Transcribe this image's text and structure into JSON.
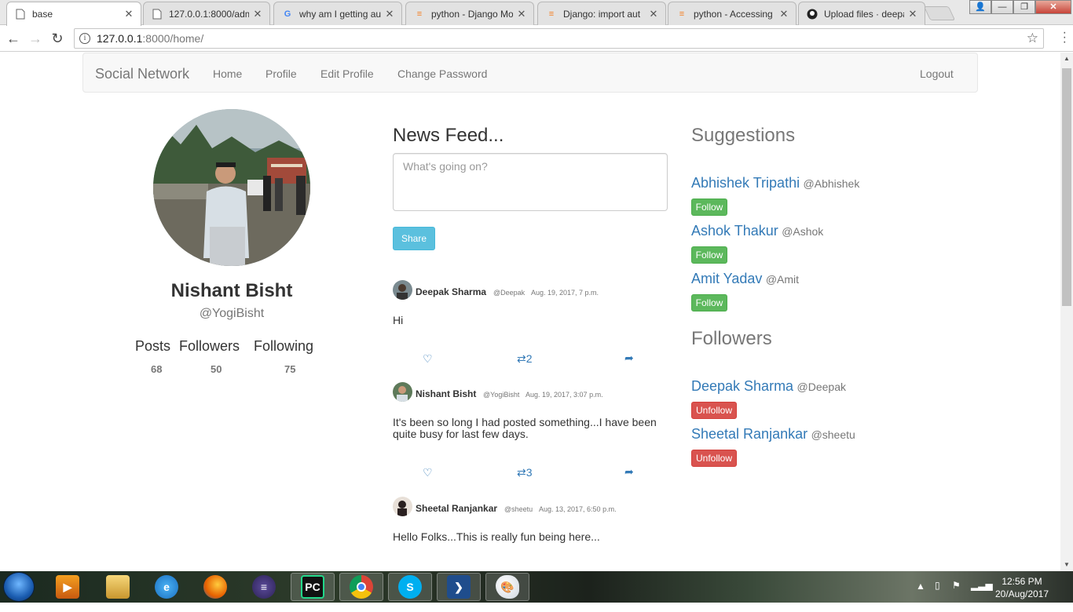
{
  "browser": {
    "tabs": [
      {
        "title": "base",
        "icon": "document-icon",
        "active": true
      },
      {
        "title": "127.0.0.1:8000/admi",
        "icon": "document-icon",
        "active": false
      },
      {
        "title": "why am I getting au",
        "icon": "google-icon",
        "active": false
      },
      {
        "title": "python - Django Mo",
        "icon": "stackoverflow-icon",
        "active": false
      },
      {
        "title": "Django: import aut",
        "icon": "stackoverflow-icon",
        "active": false
      },
      {
        "title": "python - Accessing",
        "icon": "stackoverflow-icon",
        "active": false
      },
      {
        "title": "Upload files · deepa",
        "icon": "github-icon",
        "active": false
      }
    ],
    "url_host": "127.0.0.1",
    "url_path": ":8000/home/"
  },
  "navbar": {
    "brand": "Social Network",
    "links": [
      "Home",
      "Profile",
      "Edit Profile",
      "Change Password"
    ],
    "logout": "Logout"
  },
  "profile": {
    "name": "Nishant Bisht",
    "handle": "@YogiBisht",
    "stats": [
      {
        "label": "Posts",
        "value": "68"
      },
      {
        "label": "Followers",
        "value": "50"
      },
      {
        "label": "Following",
        "value": "75"
      }
    ]
  },
  "feed": {
    "title": "News Feed...",
    "placeholder": "What's going on?",
    "share_label": "Share",
    "posts": [
      {
        "author": "Deepak Sharma",
        "handle": "@Deepak",
        "date": "Aug. 19, 2017, 7 p.m.",
        "body": "Hi",
        "retweets": "2"
      },
      {
        "author": "Nishant Bisht",
        "handle": "@YogiBisht",
        "date": "Aug. 19, 2017, 3:07 p.m.",
        "body": "It's been so long I had posted something...I have been quite busy for last few days.",
        "retweets": "3"
      },
      {
        "author": "Sheetal Ranjankar",
        "handle": "@sheetu",
        "date": "Aug. 13, 2017, 6:50 p.m.",
        "body": "Hello Folks...This is really fun being here...",
        "retweets": ""
      }
    ]
  },
  "suggestions": {
    "title": "Suggestions",
    "people": [
      {
        "name": "Abhishek Tripathi",
        "handle": "@Abhishek",
        "action": "Follow"
      },
      {
        "name": "Ashok Thakur",
        "handle": "@Ashok",
        "action": "Follow"
      },
      {
        "name": "Amit Yadav",
        "handle": "@Amit",
        "action": "Follow"
      }
    ]
  },
  "followers": {
    "title": "Followers",
    "people": [
      {
        "name": "Deepak Sharma",
        "handle": "@Deepak",
        "action": "Unfollow"
      },
      {
        "name": "Sheetal Ranjankar",
        "handle": "@sheetu",
        "action": "Unfollow"
      }
    ]
  },
  "taskbar": {
    "time": "12:56 PM",
    "date": "20/Aug/2017",
    "apps": [
      "media-player-icon",
      "file-explorer-icon",
      "internet-explorer-icon",
      "firefox-icon",
      "eclipse-icon",
      "pycharm-icon",
      "chrome-icon",
      "skype-icon",
      "powershell-icon",
      "paint-icon"
    ]
  },
  "colors": {
    "link": "#337ab7",
    "follow": "#5cb85c",
    "unfollow": "#d9534f",
    "share": "#5bc0de"
  }
}
